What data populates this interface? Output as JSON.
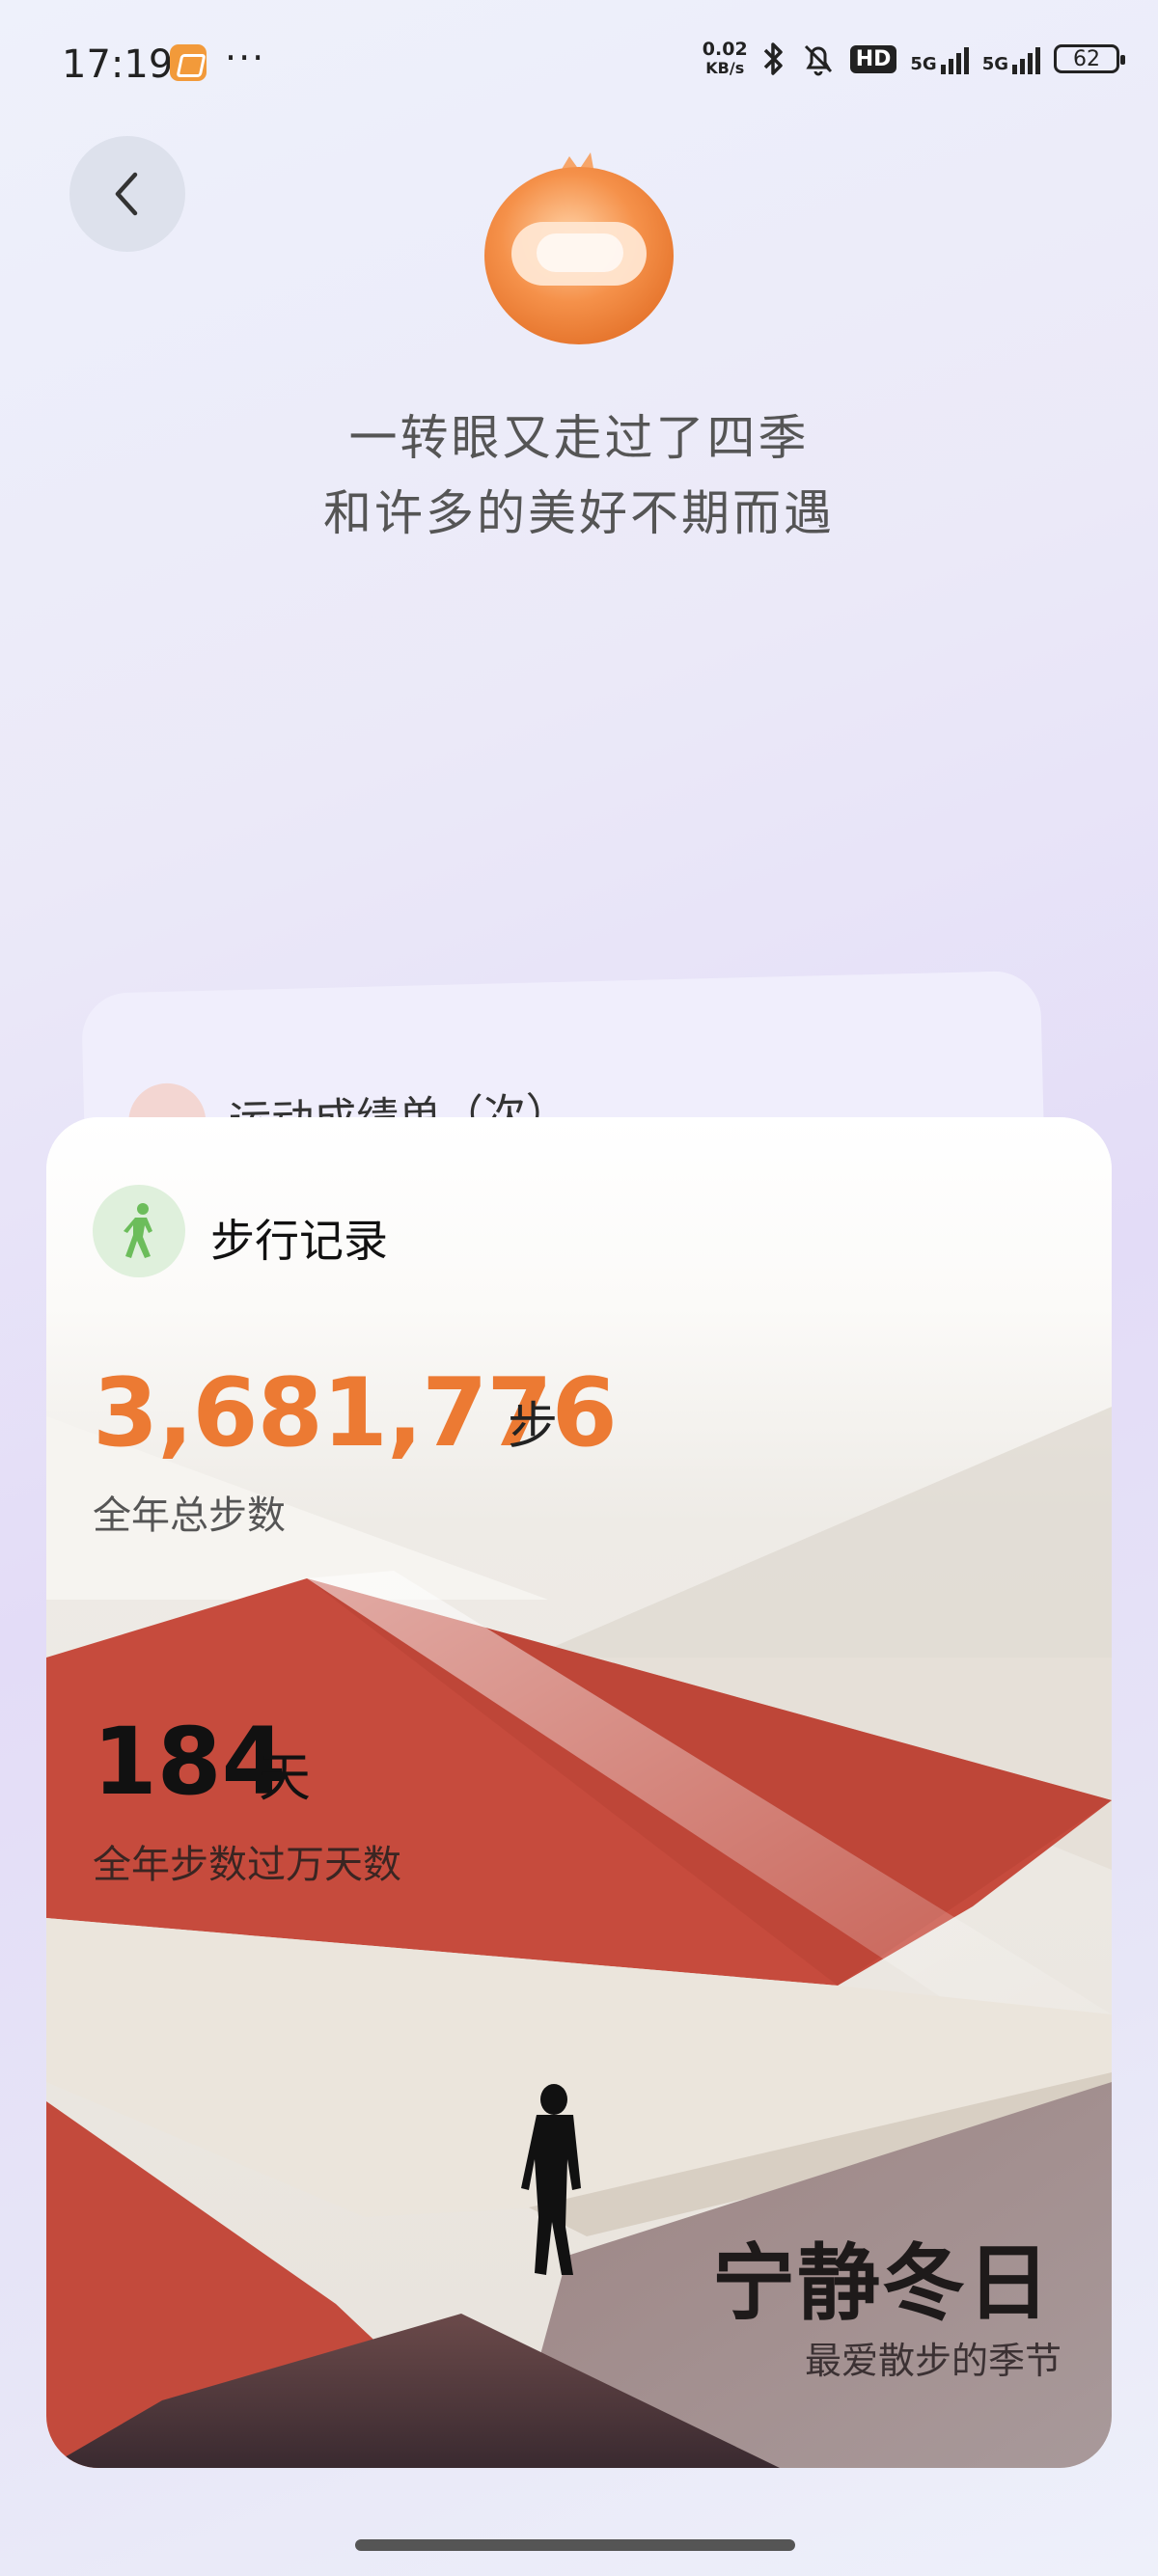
{
  "status_bar": {
    "time": "17:19",
    "dots": "···",
    "net_speed_value": "0.02",
    "net_speed_unit": "KB/s",
    "hd": "HD",
    "signal1": "5G",
    "signal2": "5G",
    "battery": "62"
  },
  "header": {
    "line1": "一转眼又走过了四季",
    "line2": "和许多的美好不期而遇"
  },
  "back_card": {
    "title": "运动成绩单（次）"
  },
  "card": {
    "title": "步行记录",
    "total_steps": "3,681,776",
    "total_steps_unit": "步",
    "total_steps_label": "全年总步数",
    "days_value": "184",
    "days_unit": "天",
    "days_label": "全年步数过万天数",
    "season_value": "宁静冬日",
    "season_label": "最爱散步的季节"
  },
  "colors": {
    "accent_orange": "#ec7a33",
    "red_band": "#c8483a",
    "walk_icon_green": "#6cbd5b"
  }
}
